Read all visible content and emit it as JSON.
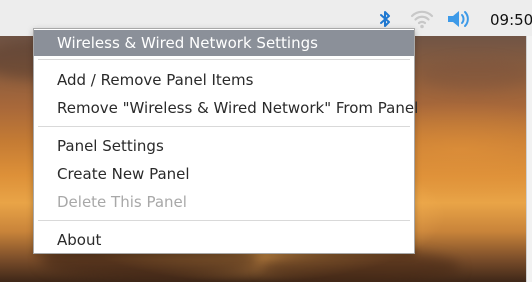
{
  "panel": {
    "clock": "09:50",
    "icons": [
      "bluetooth-icon",
      "wifi-icon",
      "volume-icon"
    ],
    "colors": {
      "panel_bg": "#ededed",
      "bluetooth": "#1f78d1",
      "wifi": "#c8c8c8",
      "volume": "#3d9ae8"
    }
  },
  "context_menu": {
    "items": [
      {
        "label": "Wireless & Wired Network Settings",
        "state": "highlighted"
      },
      {
        "label": "Add / Remove Panel Items",
        "state": "normal"
      },
      {
        "label": "Remove \"Wireless & Wired Network\" From Panel",
        "state": "normal"
      },
      {
        "label": "Panel Settings",
        "state": "normal"
      },
      {
        "label": "Create New Panel",
        "state": "normal"
      },
      {
        "label": "Delete This Panel",
        "state": "disabled"
      },
      {
        "label": "About",
        "state": "normal"
      }
    ],
    "colors": {
      "highlight_bg": "#8b9099",
      "highlight_text": "#ffffff",
      "text": "#2a2a2a",
      "disabled_text": "#a8a8a8"
    }
  }
}
